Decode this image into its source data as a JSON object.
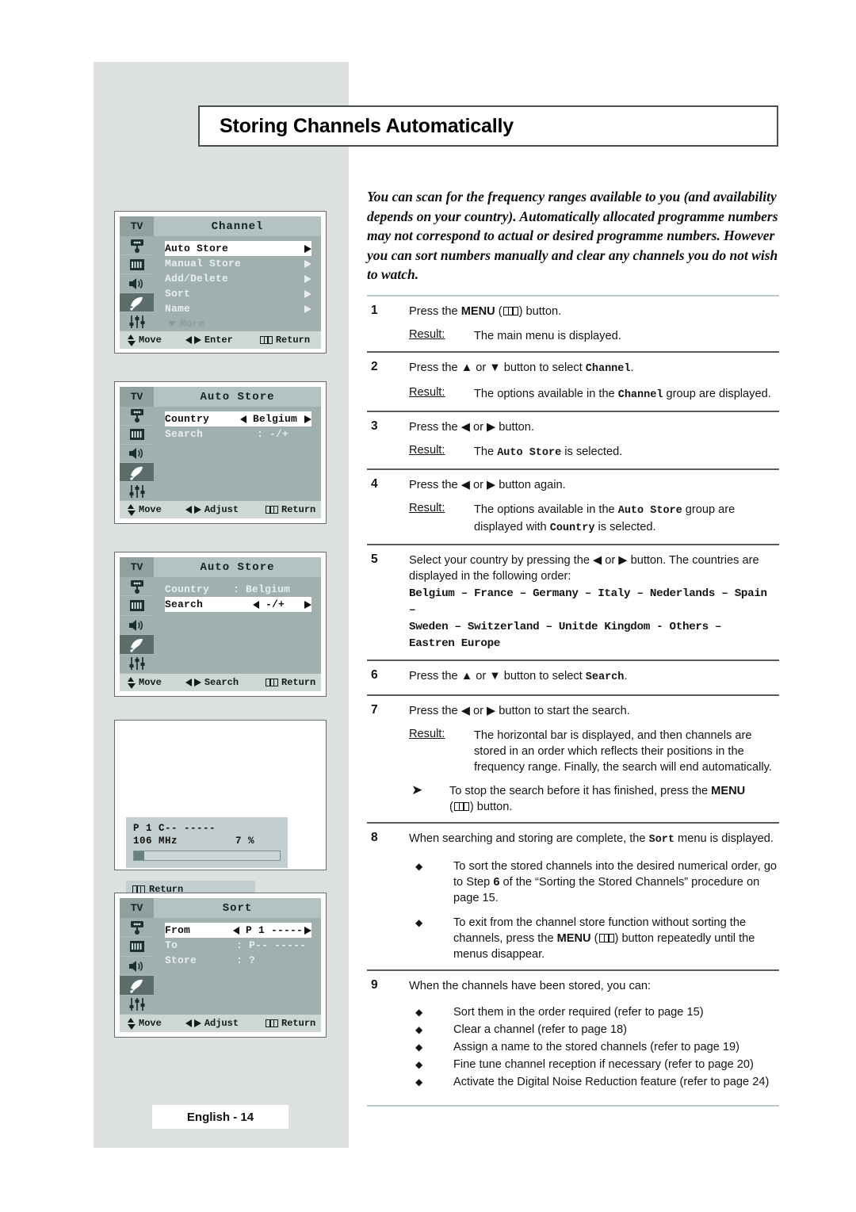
{
  "page": {
    "title": "Storing Channels Automatically",
    "footer_label": "English - 14",
    "intro": "You can scan for the frequency ranges available to you (and availability depends on your country). Automatically allocated programme numbers may not correspond to actual or desired programme numbers. However you can sort numbers manually and clear any channels you do not wish to watch.",
    "accent_color": "#9fb0ae",
    "panel_bg": "#dde1e1",
    "rule_color": "#b9cccc"
  },
  "steps": [
    {
      "num": "1",
      "text_before": "Press the ",
      "text_bold": "MENU",
      "text_after": ") button.",
      "result_label": "Result:",
      "result_text": "The main menu is displayed."
    },
    {
      "num": "2",
      "line": "Press the ▲ or ▼ button to select ",
      "line_mono": "Channel",
      "line_end": ".",
      "result_label": "Result:",
      "result_pre": "The options available in the ",
      "result_mono": "Channel",
      "result_post": " group are displayed."
    },
    {
      "num": "3",
      "line": "Press the ◀ or ▶ button.",
      "result_label": "Result:",
      "result_pre": "The ",
      "result_mono": "Auto Store",
      "result_post": " is selected."
    },
    {
      "num": "4",
      "line": "Press the ◀ or ▶ button again.",
      "result_label": "Result:",
      "result_pre": "The options available in the ",
      "result_mono": "Auto Store",
      "result_post": " group are displayed with ",
      "result_mono2": "Country",
      "result_post2": " is selected."
    },
    {
      "num": "5",
      "line": "Select your country by pressing the ◀ or ▶ button. The countries are displayed in the following order:",
      "countries_line1": "Belgium – France – Germany – Italy – Nederlands – Spain –",
      "countries_line2": "Sweden – Switzerland – Unitde Kingdom - Others –",
      "countries_line3": "Eastren Europe"
    },
    {
      "num": "6",
      "line": "Press the ▲ or ▼ button to select ",
      "line_mono": "Search",
      "line_end": "."
    },
    {
      "num": "7",
      "line": "Press the ◀ or ▶ button to start the search.",
      "result_label": "Result:",
      "result_text": "The horizontal bar is displayed, and then channels are stored in an order which reflects their positions in the frequency range. Finally, the search will end automatically.",
      "note_mark": "➤",
      "note_pre": "To stop the search before it has finished, press the ",
      "note_bold": "MENU",
      "note_post": ") button."
    },
    {
      "num": "8",
      "line_pre": "When searching and storing are complete, the ",
      "line_mono": "Sort",
      "line_post": " menu is displayed.",
      "bullets": [
        {
          "pre": "To sort the stored channels into the desired numerical order, go to Step ",
          "bold": "6",
          "post": " of the “Sorting the Stored Channels” procedure on page 15."
        },
        {
          "pre": "To exit from the channel store function without sorting the channels, press the ",
          "bold": "MENU",
          "post": ") button repeatedly until the menus disappear."
        }
      ]
    },
    {
      "num": "9",
      "line": "When the channels have been stored, you can:",
      "bullets": [
        "Sort them in the order required (refer to page 15)",
        "Clear a channel (refer to page 18)",
        "Assign a name to the stored channels (refer to page 19)",
        "Fine tune channel reception if necessary (refer to page 20)",
        "Activate the Digital Noise Reduction feature (refer to page 24)"
      ]
    }
  ],
  "osd_panels": [
    {
      "id": "channel-menu",
      "tv_label": "TV",
      "title": "Channel",
      "rows": [
        {
          "label": "Auto Store",
          "selected": true,
          "arrow": "right"
        },
        {
          "label": "Manual Store",
          "selected": false,
          "arrow": "right"
        },
        {
          "label": "Add/Delete",
          "selected": false,
          "arrow": "right"
        },
        {
          "label": "Sort",
          "selected": false,
          "arrow": "right"
        },
        {
          "label": "Name",
          "selected": false,
          "arrow": "right"
        }
      ],
      "more_label": "More",
      "footer": [
        {
          "icon": "updown-icon",
          "label": "Move"
        },
        {
          "icon": "leftright-icon",
          "label": "Enter"
        },
        {
          "icon": "menu-icon",
          "label": "Return"
        }
      ]
    },
    {
      "id": "auto-store-country",
      "tv_label": "TV",
      "title": "Auto Store",
      "fields": [
        {
          "name": "Country",
          "value": "Belgium",
          "selected": true,
          "adjustable": true
        },
        {
          "name": "Search",
          "value": ": -/+",
          "selected": false,
          "adjustable": false
        }
      ],
      "footer": [
        {
          "icon": "updown-icon",
          "label": "Move"
        },
        {
          "icon": "leftright-icon",
          "label": "Adjust"
        },
        {
          "icon": "menu-icon",
          "label": "Return"
        }
      ]
    },
    {
      "id": "auto-store-search",
      "tv_label": "TV",
      "title": "Auto Store",
      "fields": [
        {
          "name": "Country",
          "value": ": Belgium",
          "selected": false,
          "adjustable": false
        },
        {
          "name": "Search",
          "value": "-/+",
          "selected": true,
          "adjustable": true
        }
      ],
      "footer": [
        {
          "icon": "updown-icon",
          "label": "Move"
        },
        {
          "icon": "leftright-icon",
          "label": "Search"
        },
        {
          "icon": "menu-icon",
          "label": "Return"
        }
      ]
    },
    {
      "id": "sort-menu",
      "tv_label": "TV",
      "title": "Sort",
      "fields": [
        {
          "name": "From",
          "value": "P 1 -----",
          "selected": true,
          "adjustable": true
        },
        {
          "name": "To",
          "value": ": P-- -----",
          "selected": false,
          "adjustable": false
        },
        {
          "name": "Store",
          "value": ": ?",
          "selected": false,
          "adjustable": false
        }
      ],
      "footer": [
        {
          "icon": "updown-icon",
          "label": "Move"
        },
        {
          "icon": "leftright-icon",
          "label": "Adjust"
        },
        {
          "icon": "menu-icon",
          "label": "Return"
        }
      ]
    }
  ],
  "search_panel": {
    "line1": "P 1 C-- -----",
    "frequency": "106 MHz",
    "percent": "7 %",
    "progress_value": 7,
    "return_icon": "menu-icon",
    "return_label": "Return"
  },
  "sidebar_icons": [
    {
      "name": "input-source-icon",
      "selected": false
    },
    {
      "name": "picture-icon",
      "selected": false
    },
    {
      "name": "sound-icon",
      "selected": false
    },
    {
      "name": "channel-dish-icon",
      "selected": true
    },
    {
      "name": "setup-sliders-icon",
      "selected": false
    }
  ]
}
